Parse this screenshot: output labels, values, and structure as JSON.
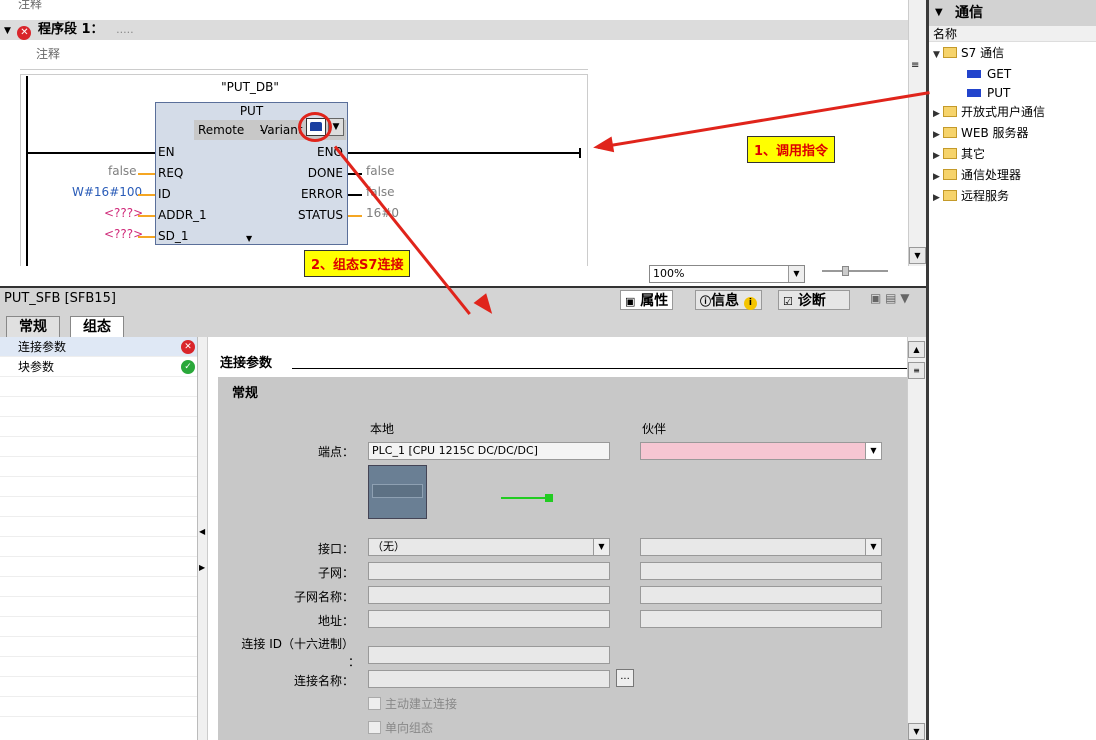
{
  "editor": {
    "top_comment": "注释",
    "network_title": "程序段 1：",
    "network_dots": ".....",
    "network_comment": "注释",
    "block_db": "\"PUT_DB\"",
    "block_name": "PUT",
    "remote_label": "Remote",
    "dash": "-",
    "variant_label": "Variant",
    "pins_left": [
      "EN",
      "REQ",
      "ID",
      "ADDR_1",
      "SD_1"
    ],
    "pins_right": [
      "ENO",
      "DONE",
      "ERROR",
      "STATUS"
    ],
    "param_req": "false",
    "param_id": "W#16#100",
    "param_addr": "<???>",
    "param_sd": "<???>",
    "out_done": "false",
    "out_error": "false",
    "out_status": "16#0",
    "zoom": "100%"
  },
  "callouts": {
    "c1": "1、调用指令",
    "c2": "2、组态S7连接"
  },
  "right_panel": {
    "title": "通信",
    "column": "名称",
    "tree": [
      {
        "label": "S7 通信",
        "expanded": true,
        "children": [
          "GET",
          "PUT"
        ]
      },
      {
        "label": "开放式用户通信"
      },
      {
        "label": "WEB 服务器"
      },
      {
        "label": "其它"
      },
      {
        "label": "通信处理器"
      },
      {
        "label": "远程服务"
      }
    ]
  },
  "properties": {
    "title": "PUT_SFB [SFB15]",
    "tabs": [
      "属性",
      "信息",
      "诊断"
    ],
    "subtabs": [
      "常规",
      "组态"
    ],
    "nav": [
      {
        "label": "连接参数",
        "status": "error"
      },
      {
        "label": "块参数",
        "status": "ok"
      }
    ],
    "section_title": "连接参数",
    "group_title": "常规",
    "col_local": "本地",
    "col_partner": "伙伴",
    "labels": {
      "endpoint": "端点：",
      "interface": "接口：",
      "subnet": "子网：",
      "subnet_name": "子网名称：",
      "address": "地址：",
      "conn_id": "连接 ID（十六进制）",
      "conn_id_colon": "：",
      "conn_name": "连接名称："
    },
    "local_endpoint": "PLC_1 [CPU 1215C DC/DC/DC]",
    "local_interface": "（无）",
    "browse": "...",
    "check_active": "主动建立连接",
    "check_oneway": "单向组态"
  },
  "colors": {
    "error": "#d9252b",
    "ok": "#2aa83a",
    "partner_endpoint": "#f6c6d2",
    "callout_bg": "#ffff00",
    "arrow": "#e0241b"
  }
}
